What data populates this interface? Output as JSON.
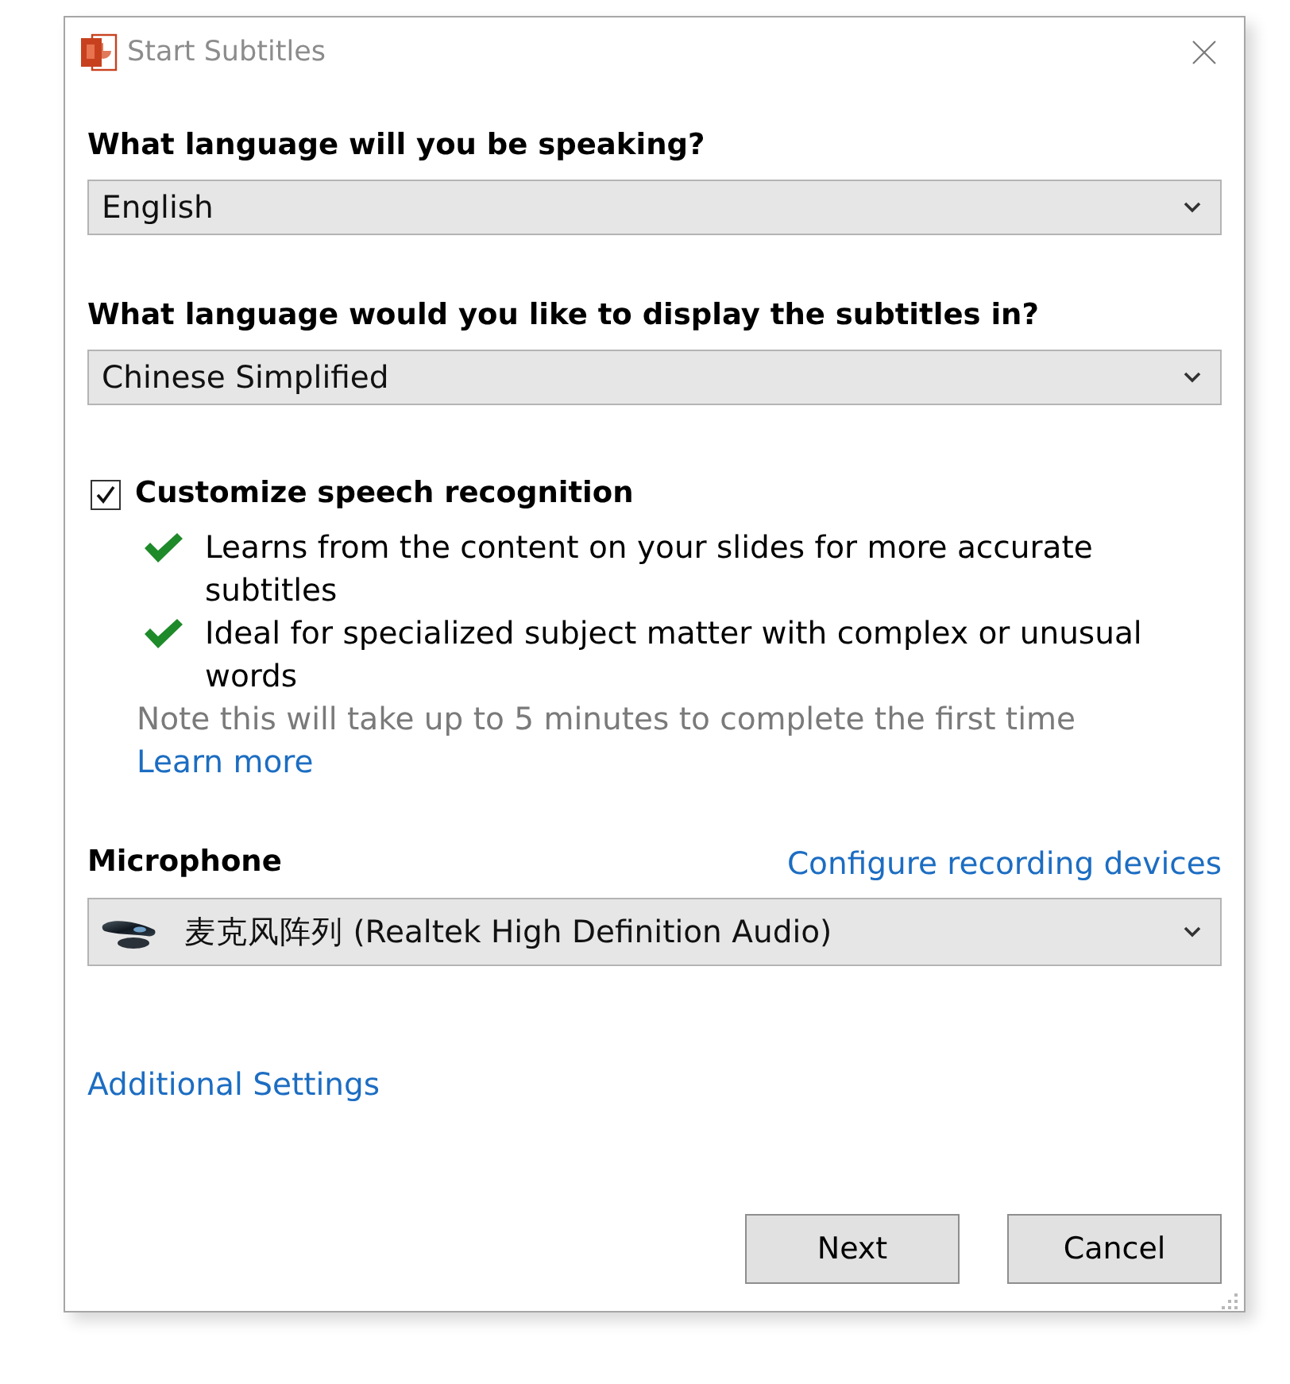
{
  "window": {
    "title": "Start Subtitles"
  },
  "speaking_language": {
    "label": "What language will you be speaking?",
    "value": "English"
  },
  "subtitle_language": {
    "label": "What language would you like to display the subtitles in?",
    "value": "Chinese Simplified"
  },
  "customize": {
    "label": "Customize speech recognition",
    "checked": true,
    "benefits": [
      "Learns from the content on your slides for more accurate subtitles",
      "Ideal for specialized subject matter with complex or unusual words"
    ],
    "note": "Note this will take up to 5 minutes to complete the first time",
    "link": "Learn more"
  },
  "microphone": {
    "label": "Microphone",
    "link": "Configure recording devices",
    "value": "麦克风阵列 (Realtek High Definition Audio)"
  },
  "additional_settings": {
    "link": "Additional Settings"
  },
  "buttons": [
    "Next",
    "Cancel"
  ]
}
